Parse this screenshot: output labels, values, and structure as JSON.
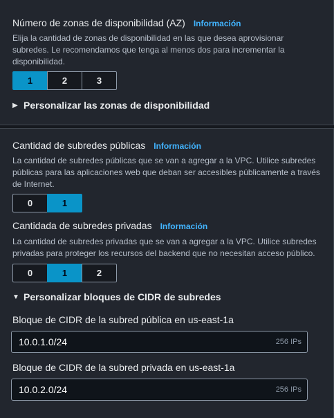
{
  "az": {
    "label": "Número de zonas de disponibilidad (AZ)",
    "info": "Información",
    "description": "Elija la cantidad de zonas de disponibilidad en las que desea aprovisionar subredes. Le recomendamos que tenga al menos dos para incrementar la disponibilidad.",
    "options": [
      "1",
      "2",
      "3"
    ],
    "selected": "1",
    "customize_label": "Personalizar las zonas de disponibilidad"
  },
  "public_subnets": {
    "label": "Cantidad de subredes públicas",
    "info": "Información",
    "description": "La cantidad de subredes públicas que se van a agregar a la VPC. Utilice subredes públicas para las aplicaciones web que deban ser accesibles públicamente a través de Internet.",
    "options": [
      "0",
      "1"
    ],
    "selected": "1"
  },
  "private_subnets": {
    "label": "Cantidada de subredes privadas",
    "info": "Información",
    "description": "La cantidad de subredes privadas que se van a agregar a la VPC. Utilice subredes privadas para proteger los recursos del backend que no necesitan acceso público.",
    "options": [
      "0",
      "1",
      "2"
    ],
    "selected": "1"
  },
  "cidr": {
    "customize_label": "Personalizar bloques de CIDR de subredes",
    "public_label": "Bloque de CIDR de la subred pública en us-east-1a",
    "public_value": "10.0.1.0/24",
    "public_suffix": "256 IPs",
    "private_label": "Bloque de CIDR de la subred privada en us-east-1a",
    "private_value": "10.0.2.0/24",
    "private_suffix": "256 IPs"
  },
  "icons": {
    "expand_collapsed": "caret-right-icon",
    "expand_open": "caret-down-icon"
  },
  "colors": {
    "selected": "#0a94c8",
    "info_link": "#42b4ff",
    "background": "#22262e"
  }
}
